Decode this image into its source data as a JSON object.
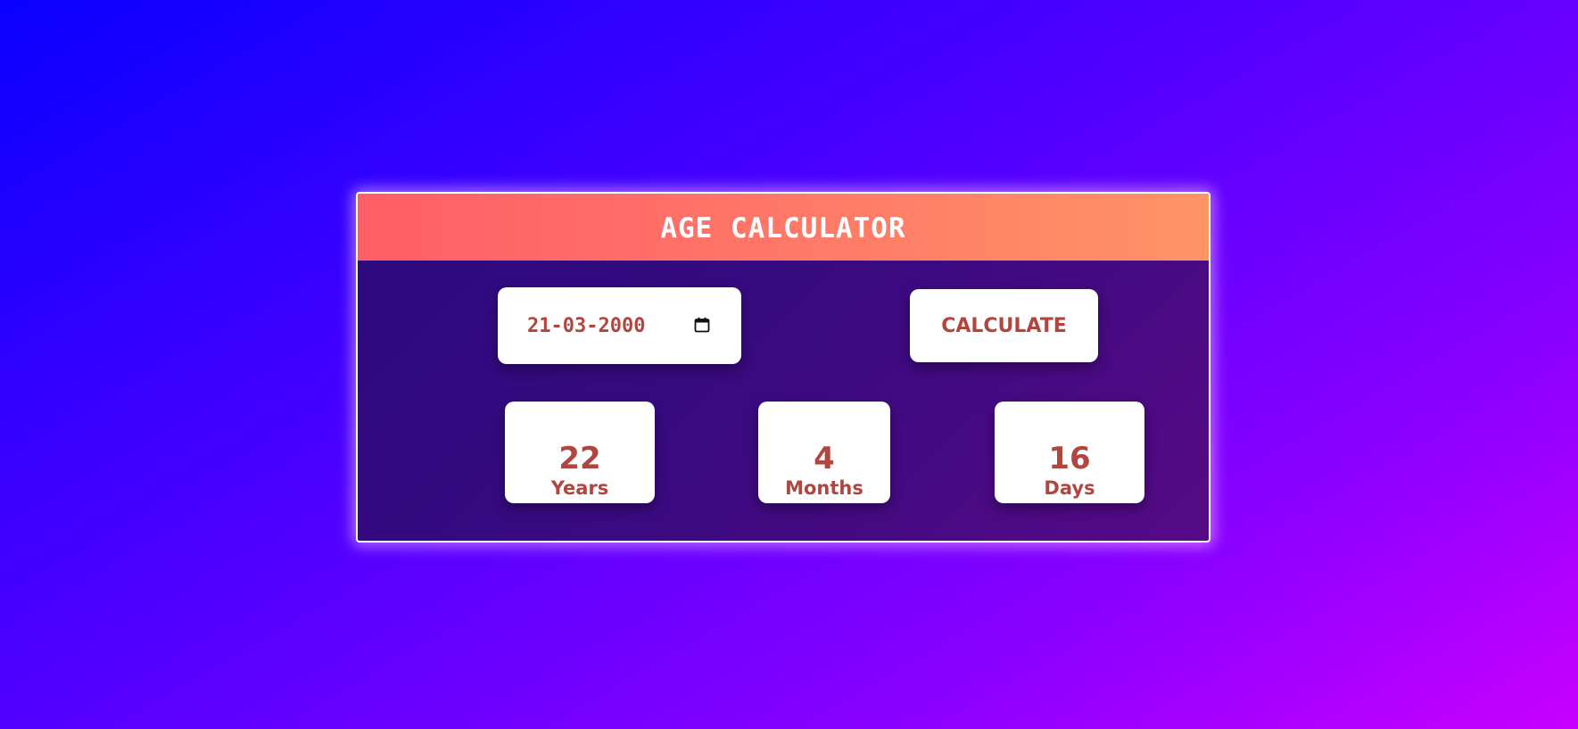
{
  "header": {
    "title": "AGE CALCULATOR"
  },
  "input": {
    "date_value": "21-03-2000",
    "icon": "calendar-icon"
  },
  "button": {
    "label": "CALCULATE"
  },
  "results": {
    "years": {
      "value": "22",
      "label": "Years"
    },
    "months": {
      "value": "4",
      "label": "Months"
    },
    "days": {
      "value": "16",
      "label": "Days"
    }
  },
  "colors": {
    "header_gradient_start": "#ff5f66",
    "header_gradient_end": "#ff9466",
    "accent_text": "#b0463f",
    "panel": "#3a0a80"
  }
}
